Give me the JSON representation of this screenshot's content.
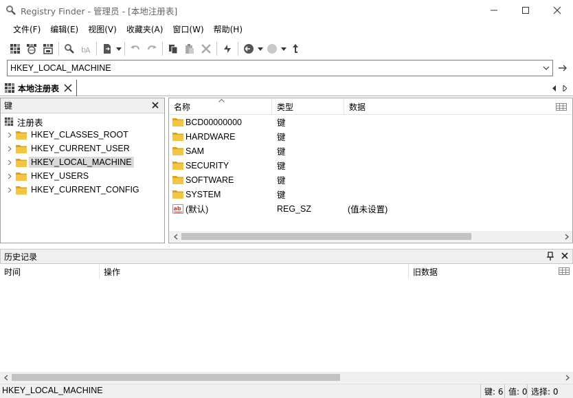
{
  "window": {
    "title": "Registry Finder - 管理员 - [本地注册表]",
    "minimize": "—",
    "maximize": "☐",
    "close": "✕",
    "icon": "magnifier-icon"
  },
  "menu": {
    "items": [
      "文件(F)",
      "编辑(E)",
      "视图(V)",
      "收藏夹(A)",
      "窗口(W)",
      "帮助(H)"
    ]
  },
  "address": {
    "value": "HKEY_LOCAL_MACHINE"
  },
  "tab": {
    "label": "本地注册表"
  },
  "keys_panel": {
    "header": "键",
    "root": "注册表",
    "items": [
      {
        "label": "HKEY_CLASSES_ROOT"
      },
      {
        "label": "HKEY_CURRENT_USER"
      },
      {
        "label": "HKEY_LOCAL_MACHINE",
        "selected": true
      },
      {
        "label": "HKEY_USERS"
      },
      {
        "label": "HKEY_CURRENT_CONFIG"
      }
    ]
  },
  "list_panel": {
    "columns": [
      "名称",
      "类型",
      "数据"
    ],
    "rows": [
      {
        "name": "BCD00000000",
        "type": "键",
        "data": "",
        "icon": "folder-icon"
      },
      {
        "name": "HARDWARE",
        "type": "键",
        "data": "",
        "icon": "folder-icon"
      },
      {
        "name": "SAM",
        "type": "键",
        "data": "",
        "icon": "folder-icon"
      },
      {
        "name": "SECURITY",
        "type": "键",
        "data": "",
        "icon": "folder-icon"
      },
      {
        "name": "SOFTWARE",
        "type": "键",
        "data": "",
        "icon": "folder-icon"
      },
      {
        "name": "SYSTEM",
        "type": "键",
        "data": "",
        "icon": "folder-icon"
      },
      {
        "name": "(默认)",
        "type": "REG_SZ",
        "data": "(值未设置)",
        "icon": "string-value-icon"
      }
    ]
  },
  "history_panel": {
    "header": "历史记录",
    "columns": [
      "时间",
      "操作",
      "旧数据"
    ]
  },
  "status": {
    "path": "HKEY_LOCAL_MACHINE",
    "keys": "键: 6",
    "values": "值: 0",
    "selection": "选择: 0"
  },
  "colors": {
    "folder": "#f4c542",
    "folder_dark": "#d9a514",
    "selection": "#d9d9d9",
    "panel_header": "#f0f0f0"
  }
}
